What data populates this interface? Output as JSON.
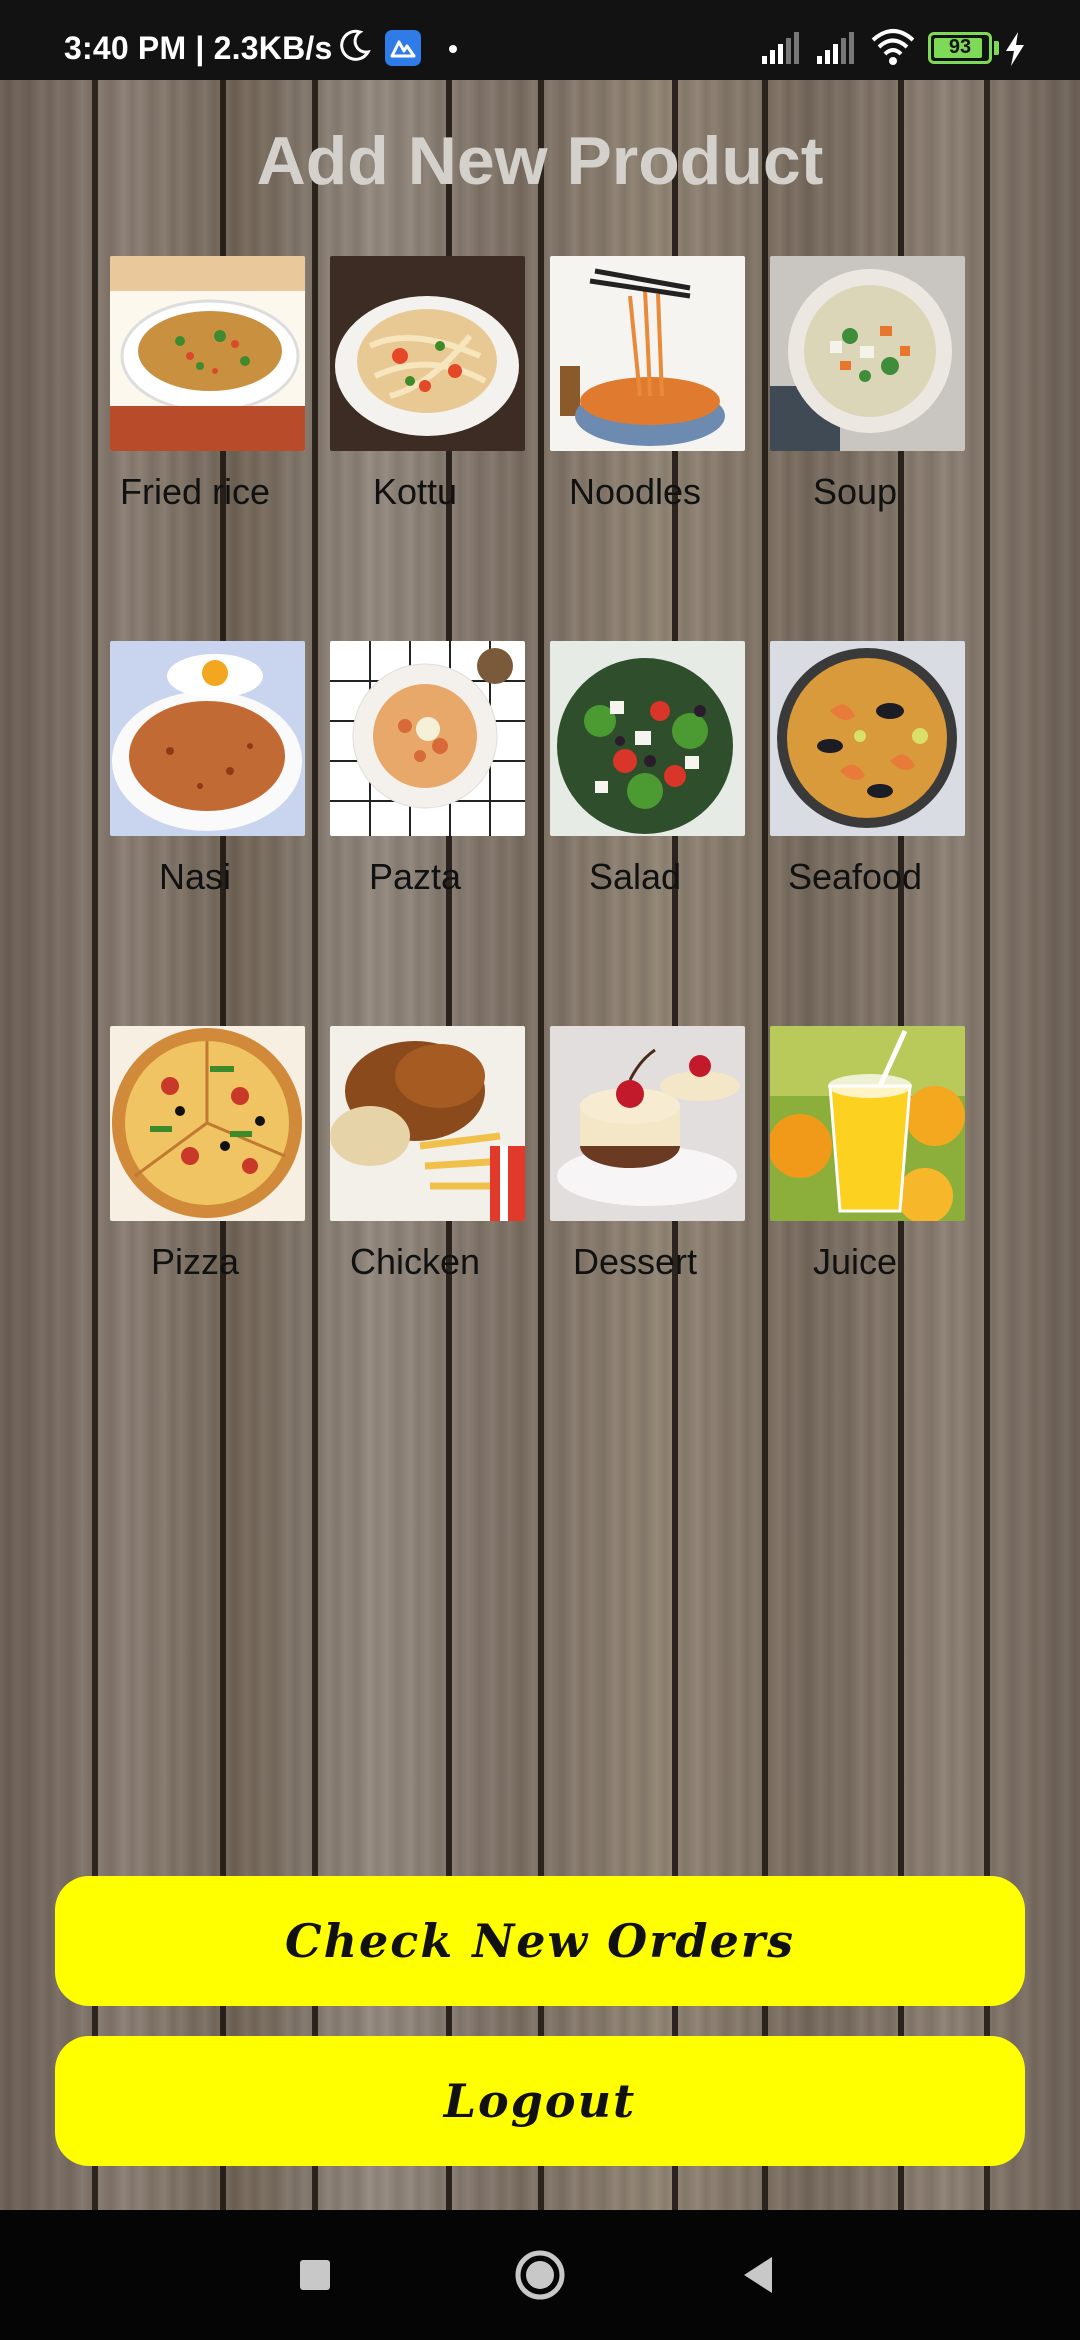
{
  "status_bar": {
    "time": "3:40 PM | 2.3KB/s",
    "battery": "93",
    "battery_level": 0.93,
    "icons": [
      "moon-icon",
      "app-badge-icon",
      "signal-icon",
      "wifi-icon",
      "battery-icon",
      "charging-icon"
    ]
  },
  "page": {
    "title": "Add New Product"
  },
  "products": [
    {
      "label": "Fried rice",
      "icon": "fried-rice-image"
    },
    {
      "label": "Kottu",
      "icon": "kottu-image"
    },
    {
      "label": "Noodles",
      "icon": "noodles-image"
    },
    {
      "label": "Soup",
      "icon": "soup-image"
    },
    {
      "label": "Nasi",
      "icon": "nasi-image"
    },
    {
      "label": "Pazta",
      "icon": "pasta-image"
    },
    {
      "label": "Salad",
      "icon": "salad-image"
    },
    {
      "label": "Seafood",
      "icon": "seafood-image"
    },
    {
      "label": "Pizza",
      "icon": "pizza-image"
    },
    {
      "label": "Chicken",
      "icon": "chicken-image"
    },
    {
      "label": "Dessert",
      "icon": "dessert-image"
    },
    {
      "label": "Juice",
      "icon": "juice-image"
    }
  ],
  "actions": {
    "check_orders": "Check New Orders",
    "logout": "Logout"
  },
  "nav": {
    "icons": [
      "recents-icon",
      "home-icon",
      "back-icon"
    ]
  },
  "colors": {
    "button": "#ffff00",
    "title": "#d4d0cb",
    "battery": "#7ed957"
  }
}
